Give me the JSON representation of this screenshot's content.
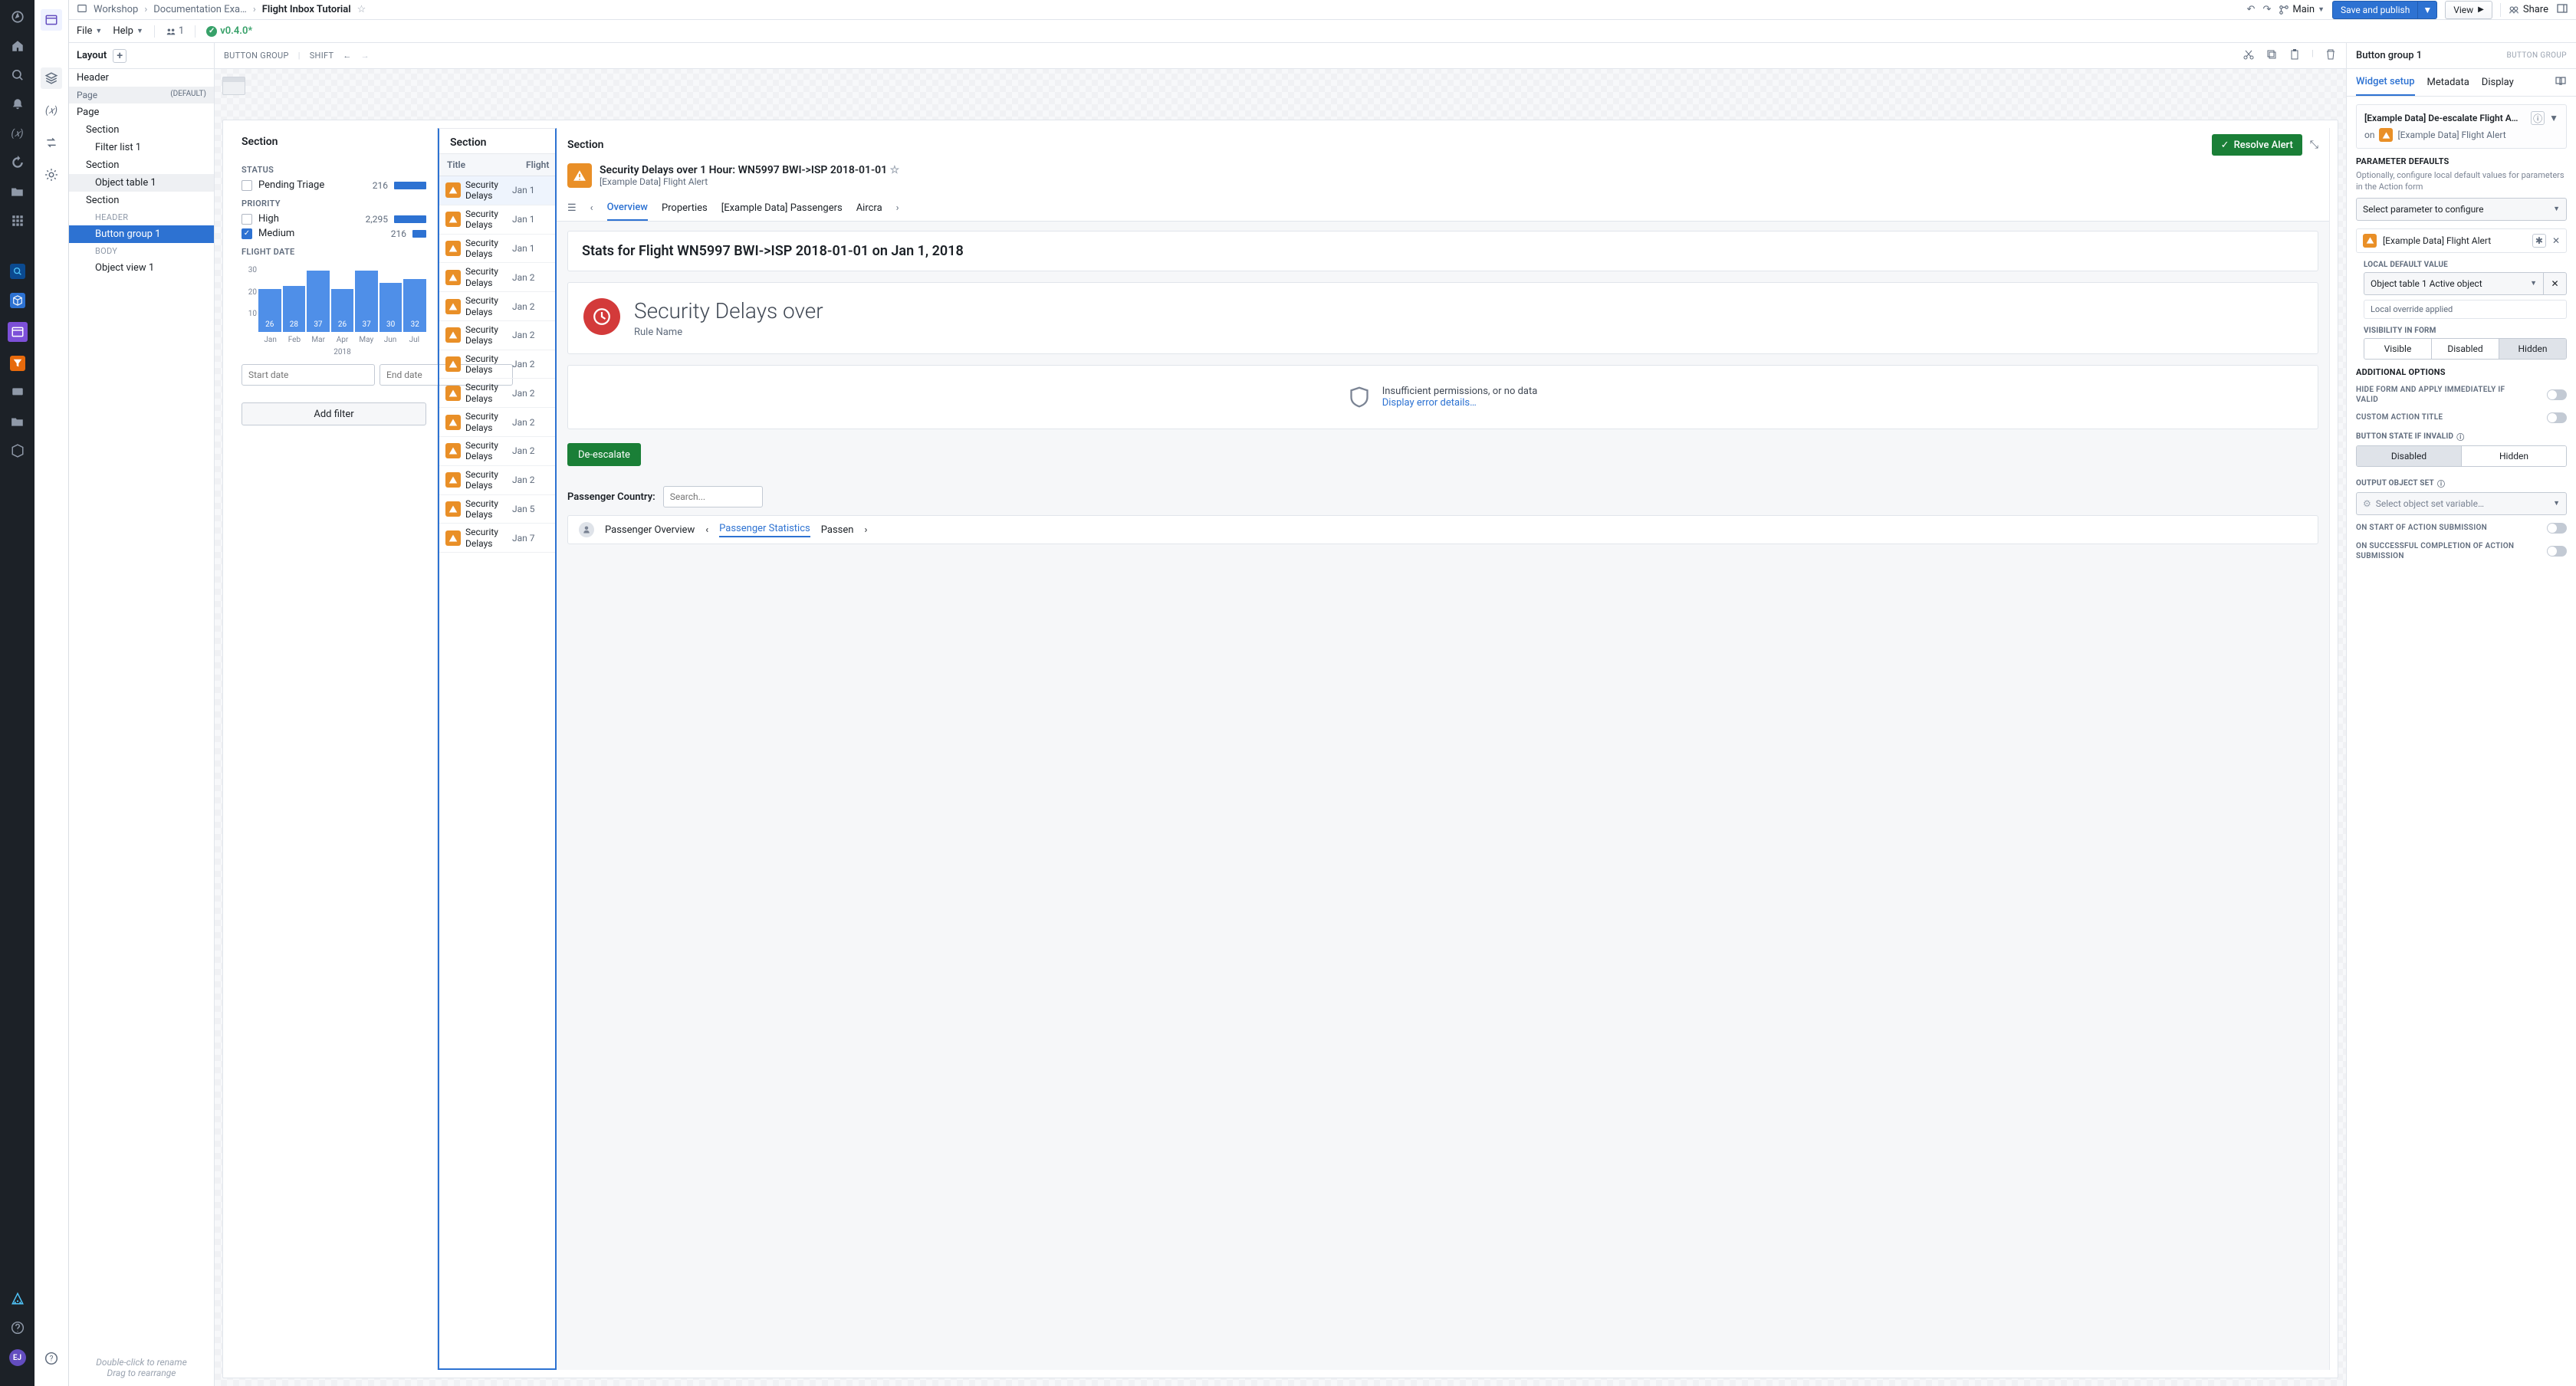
{
  "breadcrumb": {
    "folder_icon": "folder",
    "items": [
      "Workshop",
      "Documentation Exa…",
      "Flight Inbox Tutorial"
    ]
  },
  "menubar": {
    "file": "File",
    "help": "Help",
    "people_count": "1",
    "version": "v0.4.0*"
  },
  "header_actions": {
    "branch": "Main",
    "save": "Save and publish",
    "view": "View",
    "share": "Share"
  },
  "layout_panel": {
    "title": "Layout",
    "nodes": {
      "header": "Header",
      "page_default": "Page",
      "page_default_tag": "(DEFAULT)",
      "page": "Page",
      "section1": "Section",
      "filter_list": "Filter list 1",
      "section2": "Section",
      "object_table": "Object table 1",
      "section3": "Section",
      "header_sub": "HEADER",
      "button_group": "Button group 1",
      "body_sub": "BODY",
      "object_view": "Object view 1"
    },
    "hint1": "Double-click to rename",
    "hint2": "Drag to rearrange"
  },
  "canvas_toolbar": {
    "button_group": "BUTTON GROUP",
    "shift": "SHIFT"
  },
  "section_titles": {
    "left": "Section",
    "mid": "Section",
    "right": "Section"
  },
  "filters": {
    "status_label": "STATUS",
    "status_items": [
      {
        "name": "Pending Triage",
        "count": "216",
        "checked": false
      }
    ],
    "priority_label": "PRIORITY",
    "priority_items": [
      {
        "name": "High",
        "count": "2,295",
        "checked": false
      },
      {
        "name": "Medium",
        "count": "216",
        "checked": true
      }
    ],
    "flight_date_label": "FLIGHT DATE",
    "start_date_ph": "Start date",
    "end_date_ph": "End date",
    "add_filter": "Add filter"
  },
  "chart_data": {
    "type": "bar",
    "categories": [
      "Jan",
      "Feb",
      "Mar",
      "Apr",
      "May",
      "Jun",
      "Jul"
    ],
    "values": [
      26,
      28,
      37,
      26,
      37,
      30,
      32
    ],
    "ylim": [
      0,
      40
    ],
    "yticks": [
      10,
      20,
      30
    ],
    "year_label": "2018",
    "xlabel": "",
    "ylabel": ""
  },
  "object_table": {
    "headers": {
      "title": "Title",
      "date": "Flight"
    },
    "rows": [
      {
        "title": "Security Delays",
        "date": "Jan 1",
        "selected": true
      },
      {
        "title": "Security Delays",
        "date": "Jan 1"
      },
      {
        "title": "Security Delays",
        "date": "Jan 1"
      },
      {
        "title": "Security Delays",
        "date": "Jan 2"
      },
      {
        "title": "Security Delays",
        "date": "Jan 2"
      },
      {
        "title": "Security Delays",
        "date": "Jan 2"
      },
      {
        "title": "Security Delays",
        "date": "Jan 2"
      },
      {
        "title": "Security Delays",
        "date": "Jan 2"
      },
      {
        "title": "Security Delays",
        "date": "Jan 2"
      },
      {
        "title": "Security Delays",
        "date": "Jan 2"
      },
      {
        "title": "Security Delays",
        "date": "Jan 2"
      },
      {
        "title": "Security Delays",
        "date": "Jan 5"
      },
      {
        "title": "Security Delays",
        "date": "Jan 7"
      }
    ]
  },
  "detail": {
    "resolve": "Resolve Alert",
    "title": "Security Delays over 1 Hour: WN5997 BWI->ISP 2018-01-01",
    "subtitle": "[Example Data] Flight Alert",
    "tabs": [
      "Overview",
      "Properties",
      "[Example Data] Passengers",
      "Aircra"
    ],
    "stats_title": "Stats for Flight WN5997 BWI->ISP 2018-01-01 on Jan 1, 2018",
    "callout_title": "Security Delays over",
    "callout_sub": "Rule Name",
    "perm_msg": "Insufficient permissions, or no data",
    "perm_link": "Display error details…",
    "deescalate": "De-escalate",
    "passenger_country_label": "Passenger Country:",
    "search_ph": "Search...",
    "footer": {
      "overview": "Passenger Overview",
      "stats": "Passenger Statistics",
      "passen": "Passen"
    }
  },
  "config": {
    "header_title": "Button group 1",
    "header_type": "BUTTON GROUP",
    "tabs": [
      "Widget setup",
      "Metadata",
      "Display"
    ],
    "action_name": "[Example Data] De-escalate Flight A…",
    "action_on": "on",
    "action_target": "[Example Data] Flight Alert",
    "param_defaults_label": "PARAMETER DEFAULTS",
    "param_defaults_help": "Optionally, configure local default values for parameters in the Action form",
    "select_param_ph": "Select parameter to configure",
    "flight_alert_chip": "[Example Data] Flight Alert",
    "local_default_label": "LOCAL DEFAULT VALUE",
    "local_default_value": "Object table 1 Active object",
    "override_note": "Local override applied",
    "visibility_label": "VISIBILITY IN FORM",
    "visibility_options": [
      "Visible",
      "Disabled",
      "Hidden"
    ],
    "visibility_selected": "Hidden",
    "additional_label": "ADDITIONAL OPTIONS",
    "switch_hide": "HIDE FORM AND APPLY IMMEDIATELY IF VALID",
    "switch_custom_title": "CUSTOM ACTION TITLE",
    "button_state_label": "BUTTON STATE IF INVALID",
    "button_state_options": [
      "Disabled",
      "Hidden"
    ],
    "button_state_selected": "Disabled",
    "output_set_label": "OUTPUT OBJECT SET",
    "output_set_ph": "Select object set variable…",
    "switch_on_start": "ON START OF ACTION SUBMISSION",
    "switch_on_complete": "ON SUCCESSFUL COMPLETION OF ACTION SUBMISSION"
  }
}
